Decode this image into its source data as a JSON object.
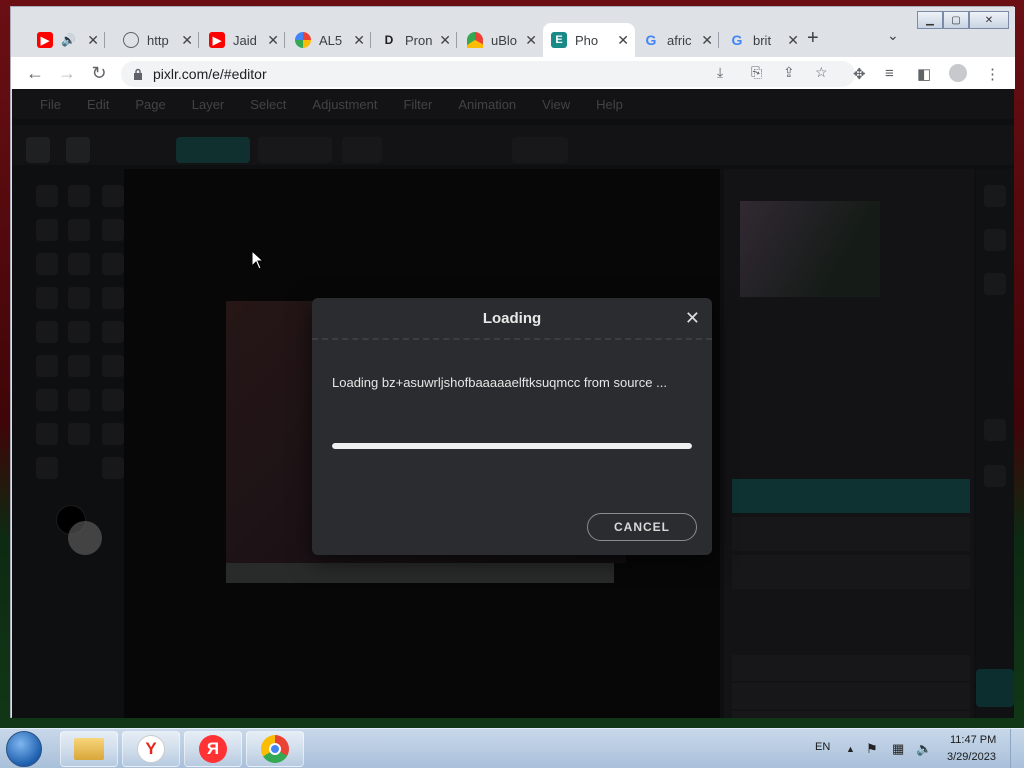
{
  "browser": {
    "tabs": [
      {
        "label": "",
        "favicon": "youtube-icon",
        "audio": true
      },
      {
        "label": "http",
        "favicon": "globe-icon"
      },
      {
        "label": "Jaid",
        "favicon": "youtube-icon"
      },
      {
        "label": "AL5",
        "favicon": "pinwheel-icon"
      },
      {
        "label": "Pron",
        "favicon": "disney-icon"
      },
      {
        "label": "uBlo",
        "favicon": "ublock-icon"
      },
      {
        "label": "Pho",
        "favicon": "pixlr-icon",
        "active": true
      },
      {
        "label": "afric",
        "favicon": "google-icon"
      },
      {
        "label": "brit",
        "favicon": "google-icon"
      }
    ],
    "url": "pixlr.com/e/#editor"
  },
  "editor": {
    "menu": [
      "File",
      "Edit",
      "Page",
      "Layer",
      "Select",
      "Adjustment",
      "Filter",
      "Animation",
      "View",
      "Help"
    ]
  },
  "dialog": {
    "title": "Loading",
    "message": "Loading bz+asuwrljshofbaaaaaelftksuqmcc from source ...",
    "progress": 1.0,
    "cancel_label": "CANCEL"
  },
  "taskbar": {
    "language": "EN",
    "time": "11:47 PM",
    "date": "3/29/2023"
  },
  "colors": {
    "dialog_bg": "#2b2c2f",
    "accent": "#14807f",
    "chrome_bar": "#dee1e6"
  }
}
